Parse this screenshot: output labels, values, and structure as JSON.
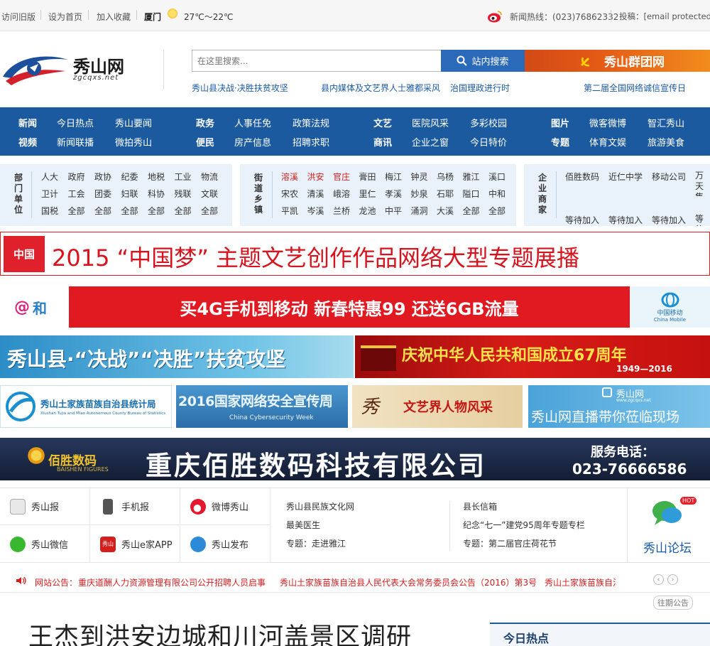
{
  "topbar": {
    "old_version": "访问旧版",
    "set_home": "设为首页",
    "add_fav": "加入收藏",
    "city": "厦门",
    "weather": "27℃～22℃",
    "hotline": "新闻热线：(023)76862332",
    "contribute": "投稿：[email protected]"
  },
  "header": {
    "logo_title": "秀山网",
    "logo_domain": "zgcqxs.net",
    "search_placeholder": "在这里搜索...",
    "search_button": "站内搜索",
    "qun_banner": "秀山群团网",
    "hot_links": [
      "秀山县决战·决胜扶贫攻坚",
      "县内媒体及文艺界人士雅都采风",
      "治国理政进行时",
      "第二届全国网络诚信宣传日"
    ]
  },
  "nav": {
    "row1": [
      "新闻",
      "今日热点",
      "秀山要闻",
      "政务",
      "人事任免",
      "政策法规",
      "文艺",
      "医院风采",
      "多彩校园",
      "图片",
      "微客微博",
      "智汇秀山"
    ],
    "row2": [
      "视频",
      "新闻联播",
      "微拍秀山",
      "便民",
      "房产信息",
      "招聘求职",
      "商讯",
      "企业之窗",
      "今日特价",
      "专题",
      "体育文娱",
      "旅游美食"
    ]
  },
  "dept": {
    "title": "部门单位",
    "rows": [
      [
        "人大",
        "政府",
        "政协",
        "纪委",
        "地税",
        "工业",
        "物流"
      ],
      [
        "卫计",
        "工会",
        "团委",
        "妇联",
        "科协",
        "残联",
        "文联"
      ],
      [
        "国税",
        "全部",
        "全部",
        "全部",
        "全部",
        "全部",
        "全部"
      ]
    ]
  },
  "towns": {
    "title": "街道乡镇",
    "rows": [
      [
        "溶溪",
        "洪安",
        "官庄",
        "膏田",
        "梅江",
        "钟灵",
        "乌杨",
        "雅江",
        "溪口"
      ],
      [
        "宋农",
        "清溪",
        "峨溶",
        "里仁",
        "孝溪",
        "妙泉",
        "石耶",
        "隘口",
        "中和"
      ],
      [
        "平凯",
        "岑溪",
        "兰桥",
        "龙池",
        "中平",
        "涌洞",
        "大溪",
        "全部",
        "全部"
      ]
    ]
  },
  "biz": {
    "title": "企业商家",
    "row1": [
      "佰胜数码",
      "近仁中学",
      "移动公司",
      "万天集团"
    ],
    "row2": [
      "等待加入",
      "等待加入",
      "等待加入",
      "等待"
    ]
  },
  "banners": {
    "dream_text": "2015 “中国梦” 主题文艺创作作品网络大型专题展播",
    "dream_badge": "中国",
    "mobile_text": "买4G手机到移动  新春特惠99  还送6GB流量",
    "mobile_left": "和",
    "mobile_right": "中国移动",
    "mobile_right_en": "China Mobile",
    "poverty_text": "秀山县·“决战”“决胜”扶贫攻坚",
    "national_text": "庆祝中华人民共和国成立67周年",
    "national_years": "1949—2016",
    "stats_text": "秀山土家族苗族自治县统计局",
    "stats_en": "Xiushan Tujia and Miao Autonomous County Bureau of Statistics",
    "cyber_text": "2016国家网络安全宣传周",
    "cyber_en": "China Cybersecurity Week",
    "artists_text": "文艺界人物风采",
    "live_brand": "秀山网",
    "live_domain": "www.zgcqxs.net",
    "live_text": "秀山网直播带你莅临现场",
    "company_name": "重庆佰胜数码科技有限公司",
    "company_logo": "佰胜数码",
    "company_logo_en": "BAISHEN FIGURES",
    "service_label": "服务电话：",
    "service_phone": "023-76666586"
  },
  "services": {
    "cells": [
      "秀山报",
      "手机报",
      "微博秀山",
      "秀山微信",
      "秀山e家APP",
      "秀山发布"
    ],
    "links_col1": [
      "秀山县民族文化网",
      "最美医生",
      "专题：走进雅江"
    ],
    "links_col2": [
      "县长信箱",
      "纪念“七一”建党95周年专题专栏",
      "专题：第二届官庄荷花节"
    ],
    "forum": "秀山论坛",
    "hot_badge": "HOT"
  },
  "notice": {
    "label": "网站公告：",
    "items": [
      "重庆道酬人力资源管理有限公司公开招聘人员启事",
      "秀山土家族苗族自治县人民代表大会常务委员会公告（2016）第3号",
      "秀山土家族苗族自治"
    ],
    "archive": "往期公告"
  },
  "main": {
    "headline": "王杰到洪安边城和川河盖景区调研",
    "today_hot": "今日热点"
  },
  "colors": {
    "nav_blue": "#1c5aa0",
    "link_blue": "#1a5aa6",
    "accent_red": "#d31d1d"
  }
}
